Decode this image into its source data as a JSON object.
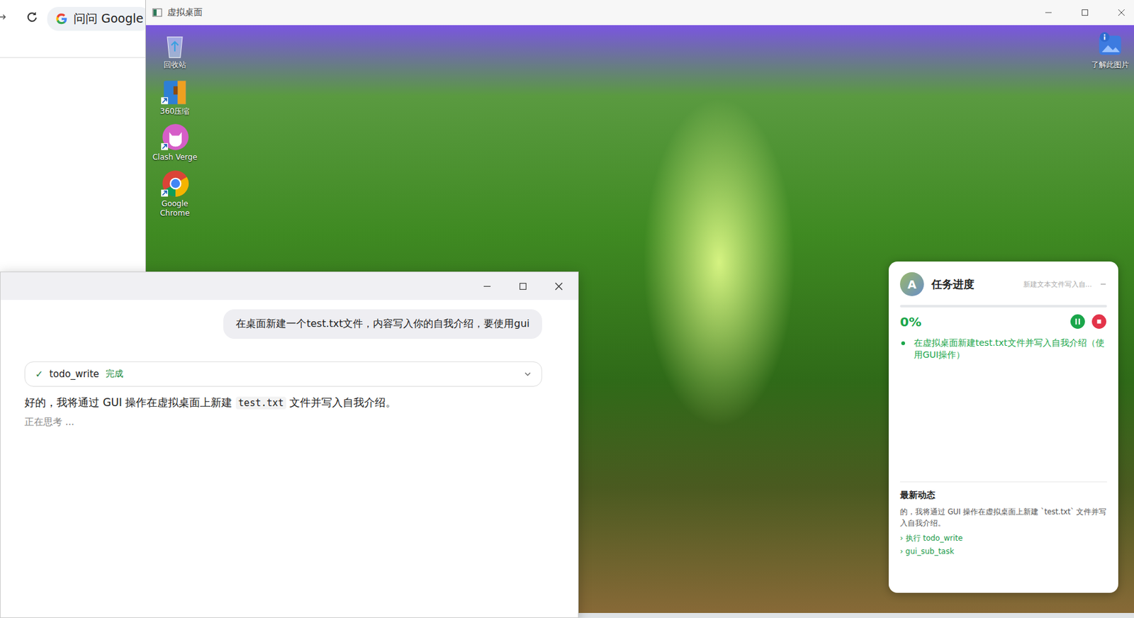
{
  "browser": {
    "address": "问问 Google"
  },
  "desktop": {
    "title": "虚拟桌面",
    "icons": [
      {
        "label": "回收站",
        "kind": "recycle"
      },
      {
        "label": "360压缩",
        "kind": "zip"
      },
      {
        "label": "Clash Verge",
        "kind": "clash"
      },
      {
        "label": "Google Chrome",
        "kind": "chrome"
      }
    ],
    "corner_icon": {
      "label": "了解此图片"
    }
  },
  "chat": {
    "user_message": "在桌面新建一个test.txt文件，内容写入你的自我介绍，要使用gui",
    "tool": {
      "icon": "✓",
      "name": "todo_write",
      "status": "完成",
      "expanded": false
    },
    "reply": {
      "before": "好的，我将通过 GUI 操作在虚拟桌面上新建 ",
      "code": "test.txt",
      "after": " 文件并写入自我介绍。"
    },
    "thinking": "正在思考 ..."
  },
  "task_panel": {
    "avatar": "A",
    "title": "任务进度",
    "subtitle": "新建文本文件写入自...",
    "percent": "0%",
    "level": 0,
    "tasks": [
      {
        "text": "在虚拟桌面新建test.txt文件并写入自我介绍（使用GUI操作）",
        "active": true
      }
    ],
    "activity_title": "最新动态",
    "activity_text": "的，我将通过 GUI 操作在虚拟桌面上新建 `test.txt` 文件并写入自我介绍。",
    "activity_links": [
      "› 执行 todo_write",
      "› gui_sub_task"
    ]
  }
}
